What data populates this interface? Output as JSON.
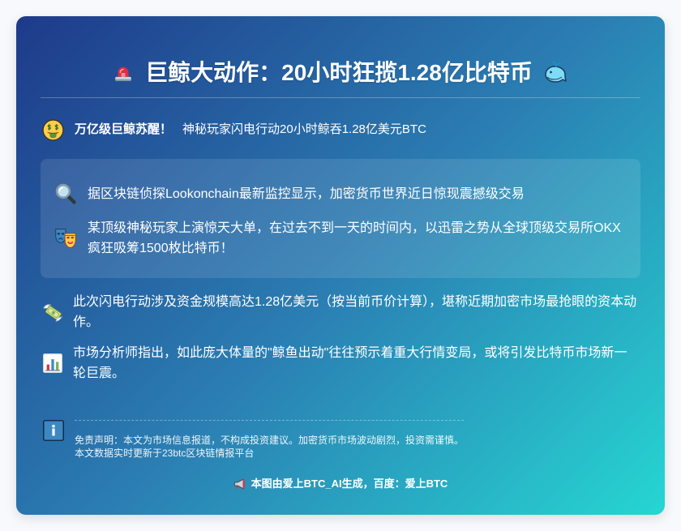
{
  "header": {
    "title": "巨鲸大动作：20小时狂揽1.28亿比特币",
    "left_icon": "siren-icon",
    "right_icon": "whale-icon"
  },
  "headline": {
    "icon": "money-mouth-face-icon",
    "bold": "万亿级巨鲸苏醒！",
    "text": "神秘玩家闪电行动20小时鲸吞1.28亿美元BTC"
  },
  "highlight_box": {
    "items": [
      {
        "icon": "magnifying-glass-icon",
        "text": "据区块链侦探Lookonchain最新监控显示，加密货币世界近日惊现震撼级交易"
      },
      {
        "icon": "performing-arts-masks-icon",
        "text": "某顶级神秘玩家上演惊天大单，在过去不到一天的时间内，以迅雷之势从全球顶级交易所OKX疯狂吸筹1500枚比特币！"
      }
    ]
  },
  "points": [
    {
      "icon": "money-with-wings-icon",
      "text": "此次闪电行动涉及资金规模高达1.28亿美元（按当前币价计算），堪称近期加密市场最抢眼的资本动作。"
    },
    {
      "icon": "bar-chart-icon",
      "text": "市场分析师指出，如此庞大体量的\"鲸鱼出动\"往往预示着重大行情变局，或将引发比特币市场新一轮巨震。"
    }
  ],
  "disclaimer": {
    "icon": "info-icon",
    "lines": [
      "免责声明：本文为市场信息报道，不构成投资建议。加密货币市场波动剧烈，投资需谨慎。",
      "本文数据实时更新于23btc区块链情报平台"
    ]
  },
  "footer": {
    "icon": "megaphone-icon",
    "text": "本图由爱上BTC_AI生成，百度：爱上BTC"
  },
  "colors": {
    "gradient_start": "#1e3a8a",
    "gradient_mid": "#2b7fb3",
    "gradient_end": "#26d6d2",
    "page_background": "#f7f9fc",
    "text": "#ffffff"
  }
}
